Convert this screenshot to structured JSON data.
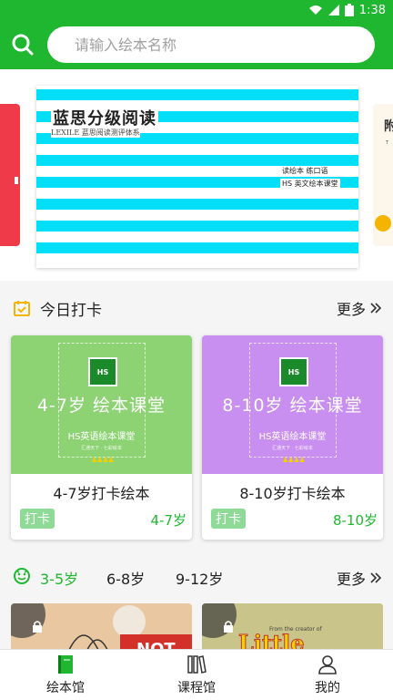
{
  "status_bar": {
    "time": "1:38",
    "icons": [
      "wifi-icon",
      "signal-icon",
      "battery-icon"
    ]
  },
  "search": {
    "placeholder": "请输入绘本名称"
  },
  "banner": {
    "title": "蓝思分级阅读",
    "subtitle": "LEXILE 蓝思阅读测评体系",
    "note1": "读绘本 练口语",
    "note2": "HS 英文绘本课堂",
    "right_peek_title": "附",
    "right_peek_sub": "T"
  },
  "checkin": {
    "title": "今日打卡",
    "more": "更多",
    "cards": [
      {
        "cover_title": "4-7岁  绘本课堂",
        "cover_sub": "HS英语绘本课堂",
        "cover_small": "汇通天下 · 七彩绘本",
        "logo": "HS",
        "name": "4-7岁打卡绘本",
        "tag": "打卡",
        "age": "4-7岁",
        "color": "#8dd374"
      },
      {
        "cover_title": "8-10岁  绘本课堂",
        "cover_sub": "HS英语绘本课堂",
        "cover_small": "汇通天下 · 七彩绘本",
        "logo": "HS",
        "name": "8-10岁打卡绘本",
        "tag": "打卡",
        "age": "8-10岁",
        "color": "#c88ef0"
      }
    ]
  },
  "age_section": {
    "tabs": [
      "3-5岁",
      "6-8岁",
      "9-12岁"
    ],
    "active": 0,
    "more": "更多",
    "book_texts": [
      "NOT",
      "Little",
      "From the creator of"
    ]
  },
  "tabbar": [
    {
      "label": "绘本馆",
      "icon": "book-icon",
      "active": true
    },
    {
      "label": "课程馆",
      "icon": "library-icon",
      "active": false
    },
    {
      "label": "我的",
      "icon": "person-icon",
      "active": false
    }
  ],
  "colors": {
    "brand": "#1fb730",
    "banner_stripe": "#00dff7",
    "tag_bg": "#90da97"
  }
}
